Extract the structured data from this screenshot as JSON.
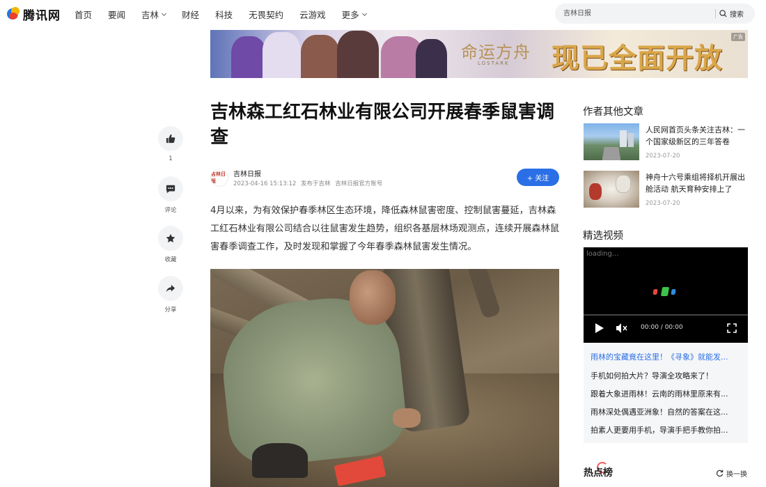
{
  "header": {
    "logo_text": "腾讯网",
    "nav": [
      {
        "label": "首页",
        "has_dropdown": false
      },
      {
        "label": "要闻",
        "has_dropdown": false
      },
      {
        "label": "吉林",
        "has_dropdown": true
      },
      {
        "label": "财经",
        "has_dropdown": false
      },
      {
        "label": "科技",
        "has_dropdown": false
      },
      {
        "label": "无畏契约",
        "has_dropdown": false
      },
      {
        "label": "云游戏",
        "has_dropdown": false
      },
      {
        "label": "更多",
        "has_dropdown": true
      }
    ],
    "search_placeholder": "吉林日报",
    "search_button": "搜索"
  },
  "ad": {
    "game_logo": "命运方舟",
    "game_logo_sub": "LOSTARK",
    "slogan": "现已全面开放",
    "tag": "广告"
  },
  "actions": {
    "like_icon": "thumbs-up-icon",
    "like_count": "1",
    "comment_label": "评论",
    "favorite_label": "收藏",
    "share_label": "分享"
  },
  "article": {
    "title": "吉林森工红石林业有限公司开展春季鼠害调查",
    "source_name": "吉林日报",
    "source_avatar_text": "吉林日报",
    "datetime": "2023-04-16 15:13:12",
    "published_at": "发布于吉林",
    "official_account": "吉林日报官方账号",
    "follow_label": "+ 关注",
    "lead": "4月以来，为有效保护春季林区生态环境，降低森林鼠害密度、控制鼠害蔓延，吉林森工红石林业有限公司结合以往鼠害发生趋势，组织各基层林场观测点，连续开展森林鼠害春季调查工作，及时发现和掌握了今年春季森林鼠害发生情况。"
  },
  "sidebar": {
    "related_heading": "作者其他文章",
    "related": [
      {
        "title": "人民网首页头条关注吉林：一个国家级新区的三年答卷",
        "date": "2023-07-20"
      },
      {
        "title": "神舟十六号乘组将择机开展出舱活动 航天育种安排上了",
        "date": "2023-07-20"
      }
    ],
    "video_heading": "精选视频",
    "video": {
      "loading_text": "loading...",
      "time": "00:00 / 00:00"
    },
    "video_list": [
      {
        "title": "雨林的宝藏竟在这里！《寻象》就能发...",
        "active": true
      },
      {
        "title": "手机如何拍大片？导演全攻略来了！",
        "active": false
      },
      {
        "title": "跟着大象进雨林！云南的雨林里原来有...",
        "active": false
      },
      {
        "title": "雨林深处偶遇亚洲象！自然的答案在这...",
        "active": false
      },
      {
        "title": "拍素人更要用手机，导演手把手教你拍...",
        "active": false
      }
    ],
    "hot_heading": "热点榜",
    "refresh_label": "换一换"
  },
  "colors": {
    "accent": "#2b6fe6",
    "hot_ring": "#f25a5a"
  }
}
